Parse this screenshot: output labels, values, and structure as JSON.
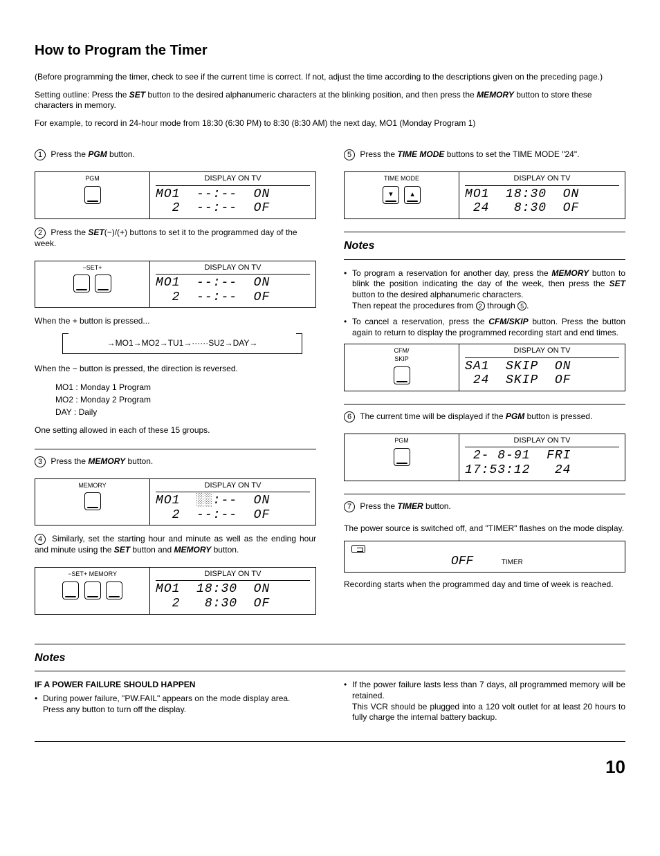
{
  "title": "How to Program the Timer",
  "intro": {
    "p1": "(Before programming the timer, check to see if the current time is correct. If not, adjust the time according to the descriptions given on the preceding page.)",
    "p2_a": "Setting outline: Press the ",
    "p2_set": "SET",
    "p2_b": " button to the desired alphanumeric characters at the blinking position, and then press the ",
    "p2_mem": "MEMORY",
    "p2_c": " button to store these characters in memory.",
    "p3": "For example, to record in 24-hour mode from 18:30 (6:30 PM) to 8:30 (8:30 AM) the next day, MO1 (Monday Program 1)"
  },
  "steps": {
    "s1": {
      "num": "1",
      "a": "Press the ",
      "btn": "PGM",
      "b": " button."
    },
    "s2": {
      "num": "2",
      "a": "Press the ",
      "btn": "SET",
      "suf": "(−)/(+)",
      "b": " buttons to set it to the programmed day of the week."
    },
    "s3": {
      "num": "3",
      "a": "Press the ",
      "btn": "MEMORY",
      "b": " button."
    },
    "s4": {
      "num": "4",
      "a": "Similarly, set the starting hour and minute as well as the ending hour and minute using the ",
      "btn1": "SET",
      "mid": " button and ",
      "btn2": "MEMORY",
      "b": " button."
    },
    "s5": {
      "num": "5",
      "a": "Press the ",
      "btn": "TIME MODE",
      "b": " buttons to set the TIME MODE \"24\"."
    },
    "s6": {
      "num": "6",
      "a": "The current time will be displayed if the ",
      "btn": "PGM",
      "b": " button is pressed."
    },
    "s7": {
      "num": "7",
      "a": "Press the ",
      "btn": "TIMER",
      "b": " button."
    }
  },
  "panels": {
    "disphead": "DISPLAY ON TV",
    "p1": {
      "head": "PGM",
      "l1": "MO1  --:--  ON",
      "l2": "  2  --:--  OF"
    },
    "p2": {
      "head": "−SET+",
      "l1": "MO1  --:--  ON",
      "l2": "  2  --:--  OF"
    },
    "p3": {
      "head": "MEMORY",
      "l1": "MO1  ░░:--  ON",
      "l2": "  2  --:--  OF"
    },
    "p4": {
      "head": "−SET+  MEMORY",
      "l1": "MO1  18:30  ON",
      "l2": "  2   8:30  OF"
    },
    "p5": {
      "head": "TIME MODE",
      "l1": "MO1  18:30  ON",
      "l2": " 24   8:30  OF"
    },
    "p6": {
      "head": "CFM/\nSKIP",
      "l1": "SA1  SKIP  ON",
      "l2": " 24  SKIP  OF"
    },
    "p7": {
      "head": "PGM",
      "l1": " 2- 8-91  FRI",
      "l2": "17:53:12   24"
    }
  },
  "extras": {
    "plus": "When the + button is pressed...",
    "seq": "→MO1→MO2→TU1→······SU2→DAY→",
    "minus": "When the − button is pressed, the direction is reversed.",
    "def1": "MO1 : Monday 1 Program",
    "def2": "MO2 : Monday 2 Program",
    "def3": "DAY : Daily",
    "one": "One setting allowed in each of these 15 groups."
  },
  "notesR": {
    "head": "Notes",
    "li1a": "To program a reservation for another day, press the ",
    "li1mem": "MEMORY",
    "li1b": " button to blink the position indicating the day of the week, then press the ",
    "li1set": "SET",
    "li1c": " button to the desired alphanumeric characters.",
    "li1d": "Then repeat the procedures from ",
    "li1n2": "2",
    "li1e": " through ",
    "li1n5": "5",
    "li1f": ".",
    "li2a": "To cancel a reservation, press the ",
    "li2btn": "CFM/SKIP",
    "li2b": " button. Press the button again to return to display the programmed recording start and end times."
  },
  "s7extra": {
    "p1": "The power source is switched off, and \"TIMER\" flashes on the mode display.",
    "seg": "OFF",
    "lbl": "TIMER",
    "p2": "Recording starts when the programmed day and time of week is reached."
  },
  "bottomNotes": {
    "head": "Notes",
    "h1": "IF A POWER FAILURE SHOULD HAPPEN",
    "l1a": "During power failure, \"PW.FAIL\" appears on the mode display area.",
    "l1b": "Press any button to turn off the display.",
    "l2a": "If the power failure lasts less than 7 days, all programmed memory will be retained.",
    "l2b": "This VCR should be plugged into a 120 volt outlet for at least 20 hours to fully charge the internal battery backup."
  },
  "pageNum": "10"
}
